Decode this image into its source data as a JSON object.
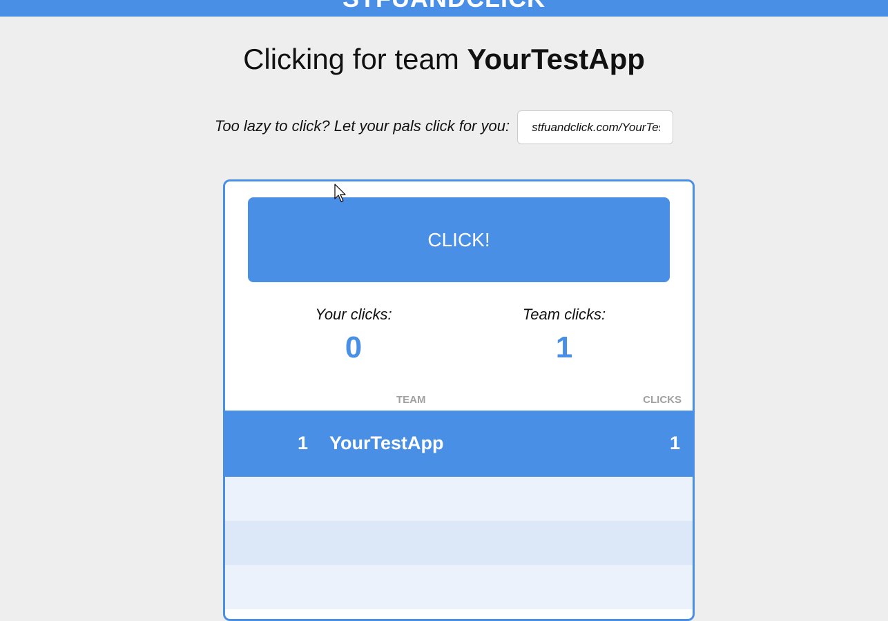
{
  "header": {
    "logo_text": "STFUANDCLICK"
  },
  "headline": {
    "prefix": "Clicking for team",
    "team_name": "YourTestApp"
  },
  "share": {
    "label": "Too lazy to click? Let your pals click for you:",
    "url_value": "stfuandclick.com/YourTestApp"
  },
  "click_button": {
    "label": "CLICK!"
  },
  "stats": {
    "your_clicks_label": "Your clicks:",
    "your_clicks_value": "0",
    "team_clicks_label": "Team clicks:",
    "team_clicks_value": "1"
  },
  "leaderboard": {
    "columns": [
      "TEAM",
      "CLICKS"
    ],
    "rows": [
      {
        "rank": "1",
        "team": "YourTestApp",
        "clicks": "1"
      }
    ]
  },
  "colors": {
    "accent": "#4a8fe6",
    "background": "#eeeeee",
    "row_light": "#ecf2fc",
    "row_mid": "#dce8f8"
  }
}
